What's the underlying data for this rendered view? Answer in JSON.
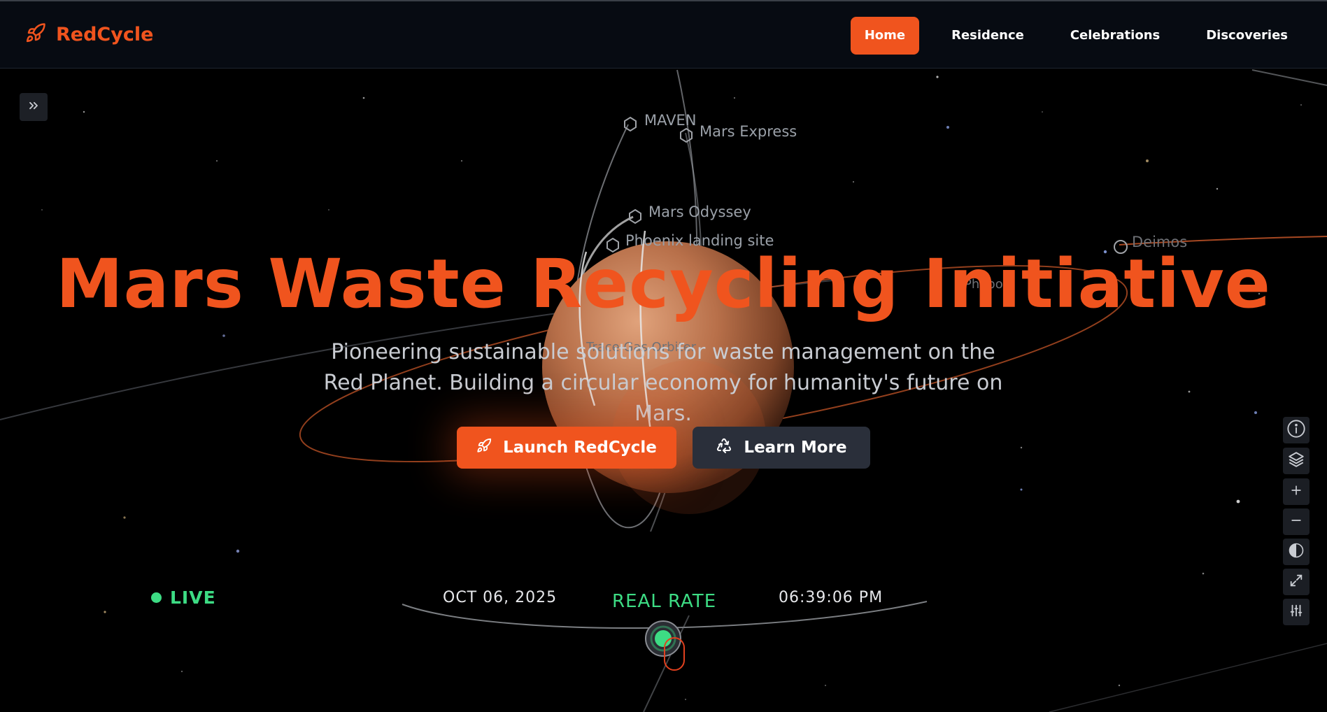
{
  "app": {
    "name": "RedCycle"
  },
  "nav": {
    "items": [
      {
        "label": "Home",
        "active": true
      },
      {
        "label": "Residence",
        "active": false
      },
      {
        "label": "Celebrations",
        "active": false
      },
      {
        "label": "Discoveries",
        "active": false
      }
    ]
  },
  "scene": {
    "labels": {
      "maven": "MAVEN",
      "mars_express": "Mars Express",
      "mars_odyssey": "Mars Odyssey",
      "phoenix": "Phoenix landing site",
      "deimos": "Deimos",
      "phobos": "Phobos",
      "tgo": "Trace Gas Orbiter"
    }
  },
  "hero": {
    "title": "Mars Waste Recycling Initiative",
    "subtitle": "Pioneering sustainable solutions for waste management on the Red Planet. Building a circular economy for humanity's future on Mars.",
    "primary_button": "Launch RedCycle",
    "secondary_button": "Learn More"
  },
  "timeline": {
    "live": "LIVE",
    "date": "OCT 06, 2025",
    "rate": "REAL RATE",
    "time": "06:39:06 PM"
  },
  "colors": {
    "accent": "#f0541e",
    "live": "#3ddc84",
    "background": "#000000",
    "header": "#070b12"
  },
  "icons": {
    "brand": "rocket-icon",
    "sidebar_toggle": "double-chevron-right-icon",
    "primary_button": "rocket-icon",
    "secondary_button": "recycle-icon",
    "controls": [
      "info-icon",
      "layers-icon",
      "zoom-in-icon",
      "zoom-out-icon",
      "contrast-icon",
      "fullscreen-icon",
      "settings-sliders-icon"
    ]
  }
}
